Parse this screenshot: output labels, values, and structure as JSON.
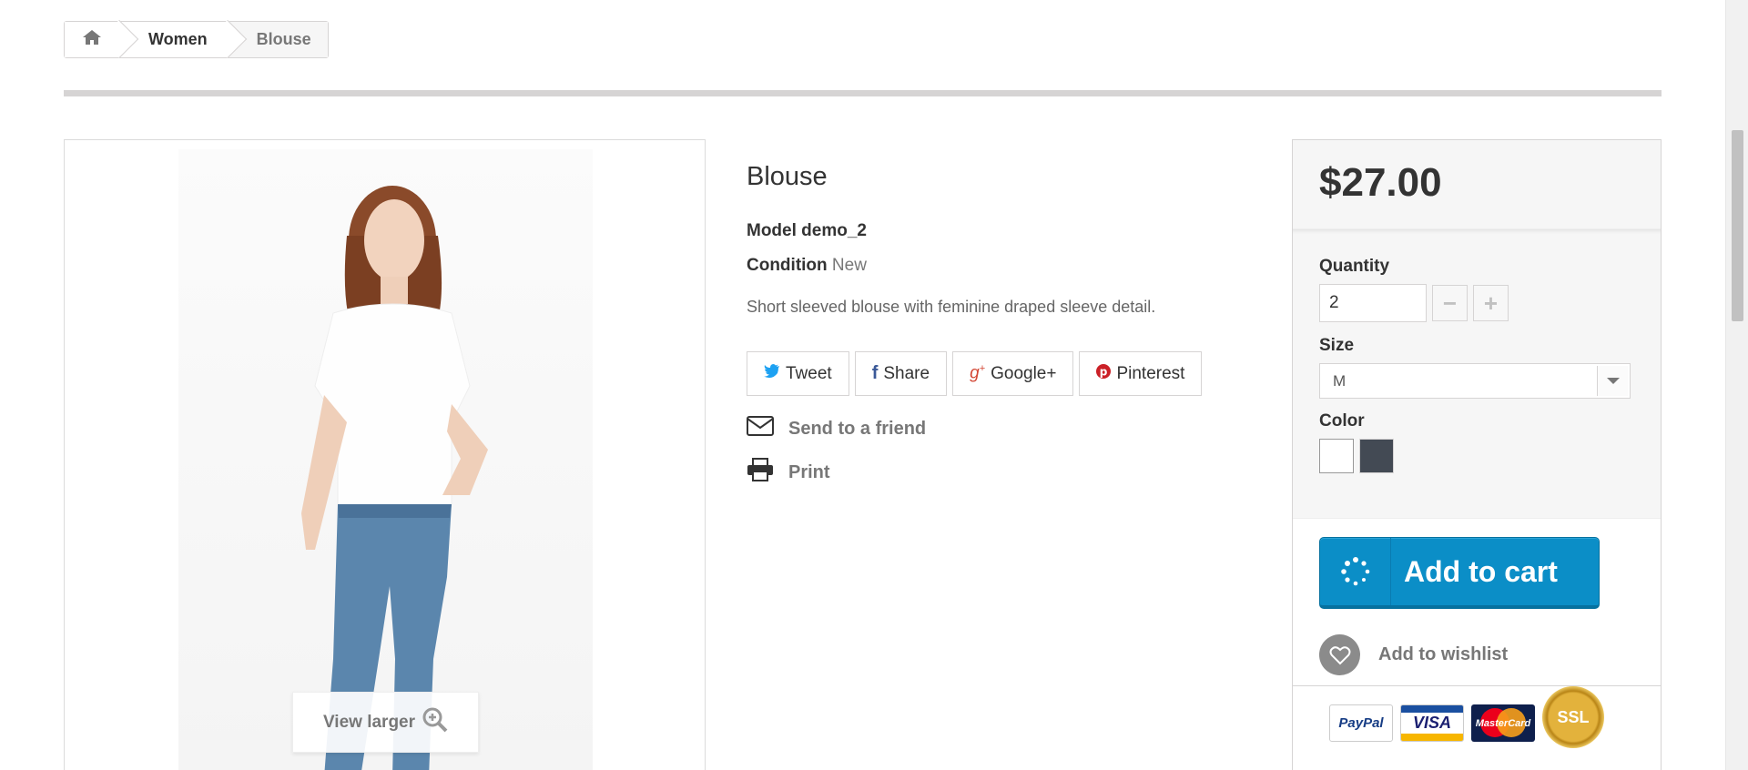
{
  "breadcrumb": {
    "home_icon": "home-icon",
    "items": [
      {
        "label": "Women"
      },
      {
        "label": "Blouse"
      }
    ]
  },
  "product": {
    "title": "Blouse",
    "model_label": "Model",
    "model_value": "demo_2",
    "condition_label": "Condition",
    "condition_value": "New",
    "description": "Short sleeved blouse with feminine draped sleeve detail.",
    "view_larger": "View larger"
  },
  "social": {
    "tweet": "Tweet",
    "share": "Share",
    "google": "Google+",
    "pinterest": "Pinterest"
  },
  "actions": {
    "send_friend": "Send to a friend",
    "print": "Print"
  },
  "buy": {
    "price": "$27.00",
    "quantity_label": "Quantity",
    "quantity_value": "2",
    "size_label": "Size",
    "size_value": "M",
    "color_label": "Color",
    "colors": [
      "#ffffff",
      "#434a54"
    ],
    "add_to_cart": "Add to cart",
    "add_to_wishlist": "Add to wishlist",
    "cart_button_color": "#0b8ec7"
  },
  "payment": {
    "paypal": "PayPal",
    "visa": "VISA",
    "mastercard": "MasterCard",
    "ssl": "SSL"
  }
}
